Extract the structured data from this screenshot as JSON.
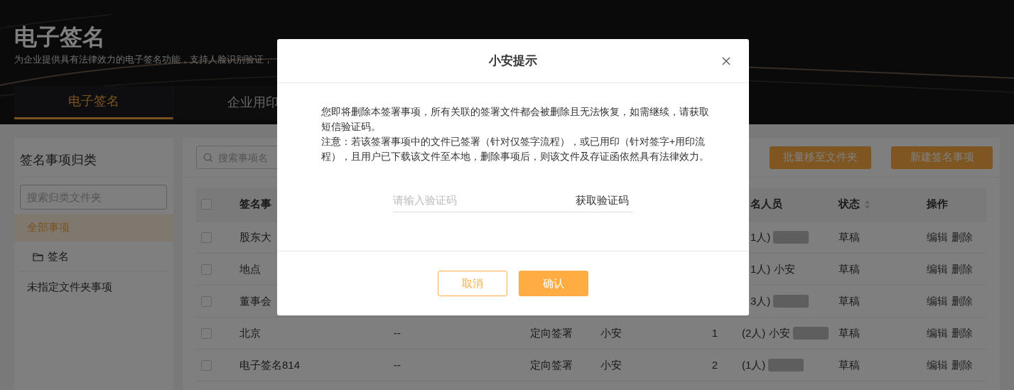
{
  "header": {
    "title": "电子签名",
    "subtitle": "为企业提供具有法律效力的电子签名功能，支持人脸识别验证，",
    "tabs": [
      {
        "label": "电子签名",
        "selected": true
      },
      {
        "label": "企业用印",
        "selected": false
      }
    ]
  },
  "sidebar": {
    "title": "签名事项归类",
    "search_placeholder": "搜索归类文件夹",
    "items": [
      {
        "kind": "all",
        "label": "全部事项",
        "selected": true
      },
      {
        "kind": "folder",
        "label": "签名",
        "selected": false
      },
      {
        "kind": "plain",
        "label": "未指定文件夹事项",
        "selected": false
      }
    ]
  },
  "toolbar": {
    "search_placeholder": "搜索事项名",
    "buttons": [
      "批量移至文件夹",
      "新建签名事项"
    ]
  },
  "table": {
    "header_checked": false,
    "columns": [
      {
        "label": "签名事",
        "sortable": false
      },
      {
        "label": "名人员",
        "sortable": false
      },
      {
        "label": "状态",
        "sortable": true
      },
      {
        "label": "操作",
        "sortable": false
      }
    ],
    "rows": [
      {
        "checked": false,
        "name": "股东大",
        "signers": "1人)",
        "signer_redacted": true,
        "status": "草稿",
        "actions": [
          "编辑",
          "删除"
        ]
      },
      {
        "checked": false,
        "name": "地点",
        "signers": "1人) 小安",
        "signer_redacted": false,
        "status": "草稿",
        "actions": [
          "编辑",
          "删除"
        ]
      },
      {
        "checked": false,
        "name": "董事会",
        "signers": "3人)",
        "signer_redacted": true,
        "status": "草稿",
        "actions": [
          "编辑",
          "删除"
        ]
      },
      {
        "checked": false,
        "name": "北京",
        "description": "--",
        "type": "定向签署",
        "initiator": "小安",
        "count": "1",
        "signers": "(2人) 小安",
        "signer_redacted": true,
        "status": "草稿",
        "actions": [
          "编辑",
          "删除"
        ]
      },
      {
        "checked": false,
        "name": "电子签名814",
        "description": "--",
        "type": "定向签署",
        "initiator": "小安",
        "count": "2",
        "signers": "(1人)",
        "signer_redacted": true,
        "status": "草稿",
        "actions": [
          "编辑",
          "删除"
        ]
      }
    ]
  },
  "dialog": {
    "title": "小安提示",
    "paragraphs": [
      "您即将删除本签署事项，所有关联的签署文件都会被删除且无法恢复，如需继续，请获取短信验证码。",
      "注意：若该签署事项中的文件已签署（针对仅签字流程），或已用印（针对签字+用印流程），且用户已下载该文件至本地，删除事项后，则该文件及存证函依然具有法律效力。"
    ],
    "code_placeholder": "请输入验证码",
    "get_code": "获取验证码",
    "buttons": [
      {
        "kind": "secondary",
        "label": "取消"
      },
      {
        "kind": "primary",
        "label": "确认"
      }
    ]
  }
}
